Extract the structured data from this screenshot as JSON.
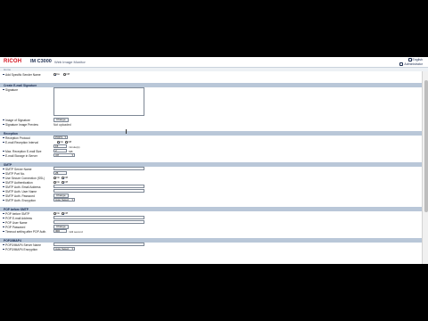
{
  "header": {
    "brand": "RICOH",
    "model": "IM C3000",
    "app_title": "Web Image Monitor",
    "right_line1": "English",
    "right_line2": "Administrator"
  },
  "userbar": {
    "text": "Home"
  },
  "top_rows": [
    {
      "label": "Add Specific Sender Name",
      "radio_on": "Do",
      "radio_off": "Off"
    }
  ],
  "sections": {
    "signature": "Create E-mail Signature",
    "reception": "Reception",
    "smtp": "SMTP",
    "pop_imap": "POP before SMTP",
    "pop3_imap4": "POP3/IMAP4"
  },
  "signature": {
    "label": "Signature",
    "image_label": "Image of Signature",
    "image_button": "Change",
    "preview_label": "Signature Image Preview",
    "preview_value": "Not uploaded"
  },
  "reception": {
    "protocol_label": "Reception Protocol",
    "protocol_value": "POP3",
    "interval_label": "E-mail Reception Interval",
    "interval_on": "On",
    "interval_off": "Off",
    "interval_value": "15",
    "interval_unit": "minute(s)",
    "max_size_label": "Max. Reception E-mail Size",
    "max_size_value": "2",
    "max_size_unit": "MB",
    "storage_label": "E-mail Storage in Server",
    "storage_value": "Off"
  },
  "smtp": {
    "server_label": "SMTP Server Name",
    "port_label": "SMTP Port No.",
    "port_value": "25",
    "secure_label": "Use Secure Connection (SSL)",
    "secure_on": "On",
    "secure_off": "Off",
    "auth_label": "SMTP Authentication",
    "auth_on": "On",
    "auth_off": "Off",
    "auth_email_label": "SMTP Auth. Email Address",
    "auth_user_label": "SMTP Auth. User Name",
    "auth_pass_label": "SMTP Auth. Password",
    "auth_pass_button": "Change",
    "auth_enc_label": "SMTP Auth. Encryption",
    "auth_enc_value": "Auto Select"
  },
  "pop": {
    "pop_smtp_label": "POP before SMTP",
    "pop_on": "On",
    "pop_off": "Off",
    "email_label": "POP E-mail Address",
    "user_label": "POP User Name",
    "pass_label": "POP Password",
    "pass_button": "Change",
    "timeout_label": "Timeout setting after POP Auth.",
    "timeout_value": "300",
    "timeout_unit": "milli second"
  },
  "pop3": {
    "server_label": "POP3/IMAP4 Server Name",
    "enc_label": "POP3/IMAP4 Encryption",
    "enc_value": "Auto Select"
  }
}
